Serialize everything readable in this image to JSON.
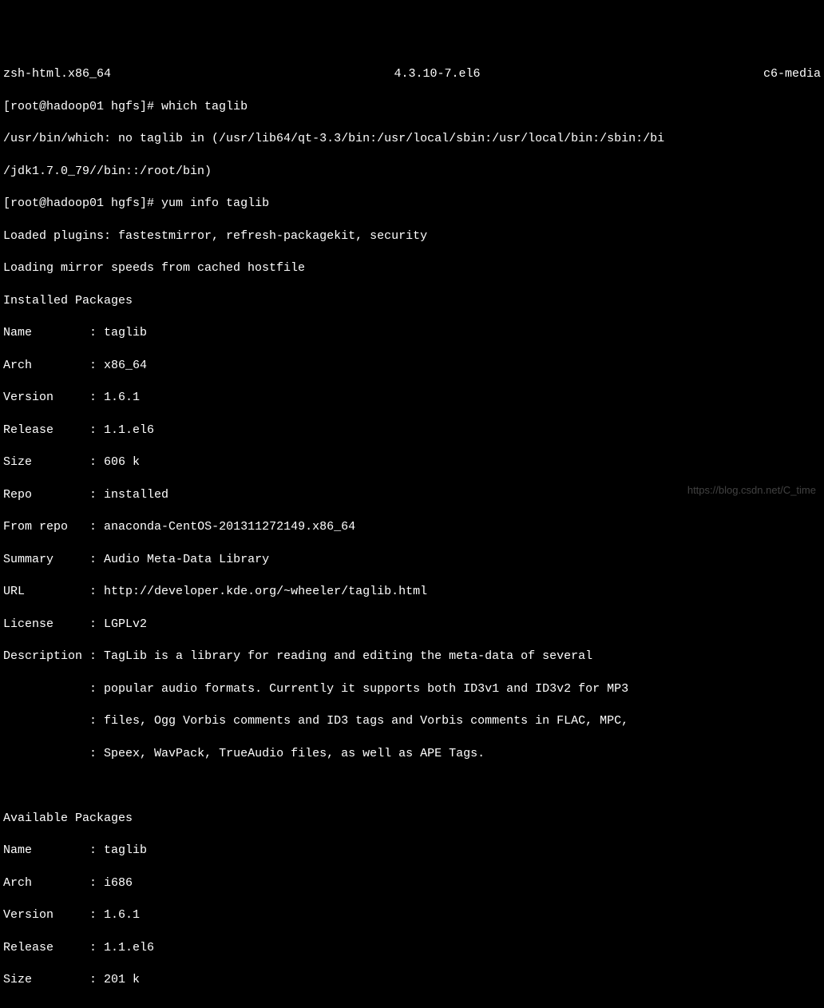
{
  "header": {
    "left": "zsh-html.x86_64",
    "center": "4.3.10-7.el6",
    "right": "c6-media"
  },
  "prompt1": {
    "prefix": "[root@hadoop01 hgfs]# ",
    "command": "which taglib"
  },
  "which_output_line1": "/usr/bin/which: no taglib in (/usr/lib64/qt-3.3/bin:/usr/local/sbin:/usr/local/bin:/sbin:/bi",
  "which_output_line2": "/jdk1.7.0_79//bin::/root/bin)",
  "prompt2": {
    "prefix": "[root@hadoop01 hgfs]# ",
    "command": "yum info taglib"
  },
  "loaded_plugins": "Loaded plugins: fastestmirror, refresh-packagekit, security",
  "loading_mirror": "Loading mirror speeds from cached hostfile",
  "installed_packages_header": "Installed Packages",
  "installed": {
    "name": {
      "label": "Name        ",
      "sep": ": ",
      "value": "taglib"
    },
    "arch": {
      "label": "Arch        ",
      "sep": ": ",
      "value": "x86_64"
    },
    "version": {
      "label": "Version     ",
      "sep": ": ",
      "value": "1.6.1"
    },
    "release": {
      "label": "Release     ",
      "sep": ": ",
      "value": "1.1.el6"
    },
    "size": {
      "label": "Size        ",
      "sep": ": ",
      "value": "606 k"
    },
    "repo": {
      "label": "Repo        ",
      "sep": ": ",
      "value": "installed"
    },
    "from_repo": {
      "label": "From repo   ",
      "sep": ": ",
      "value": "anaconda-CentOS-201311272149.x86_64"
    },
    "summary": {
      "label": "Summary     ",
      "sep": ": ",
      "value": "Audio Meta-Data Library"
    },
    "url": {
      "label": "URL         ",
      "sep": ": ",
      "value": "http://developer.kde.org/~wheeler/taglib.html"
    },
    "license": {
      "label": "License     ",
      "sep": ": ",
      "value": "LGPLv2"
    },
    "desc1": {
      "label": "Description ",
      "sep": ": ",
      "value": "TagLib is a library for reading and editing the meta-data of several"
    },
    "desc2": {
      "label": "            ",
      "sep": ": ",
      "value": "popular audio formats. Currently it supports both ID3v1 and ID3v2 for MP3"
    },
    "desc3": {
      "label": "            ",
      "sep": ": ",
      "value": "files, Ogg Vorbis comments and ID3 tags and Vorbis comments in FLAC, MPC,"
    },
    "desc4": {
      "label": "            ",
      "sep": ": ",
      "value": "Speex, WavPack, TrueAudio files, as well as APE Tags."
    }
  },
  "available_packages_header": "Available Packages",
  "available": {
    "name": {
      "label": "Name        ",
      "sep": ": ",
      "value": "taglib"
    },
    "arch": {
      "label": "Arch        ",
      "sep": ": ",
      "value": "i686"
    },
    "version": {
      "label": "Version     ",
      "sep": ": ",
      "value": "1.6.1"
    },
    "release": {
      "label": "Release     ",
      "sep": ": ",
      "value": "1.1.el6"
    },
    "size": {
      "label": "Size        ",
      "sep": ": ",
      "value": "201 k"
    }
  },
  "watermark": "https://blog.csdn.net/C_time"
}
